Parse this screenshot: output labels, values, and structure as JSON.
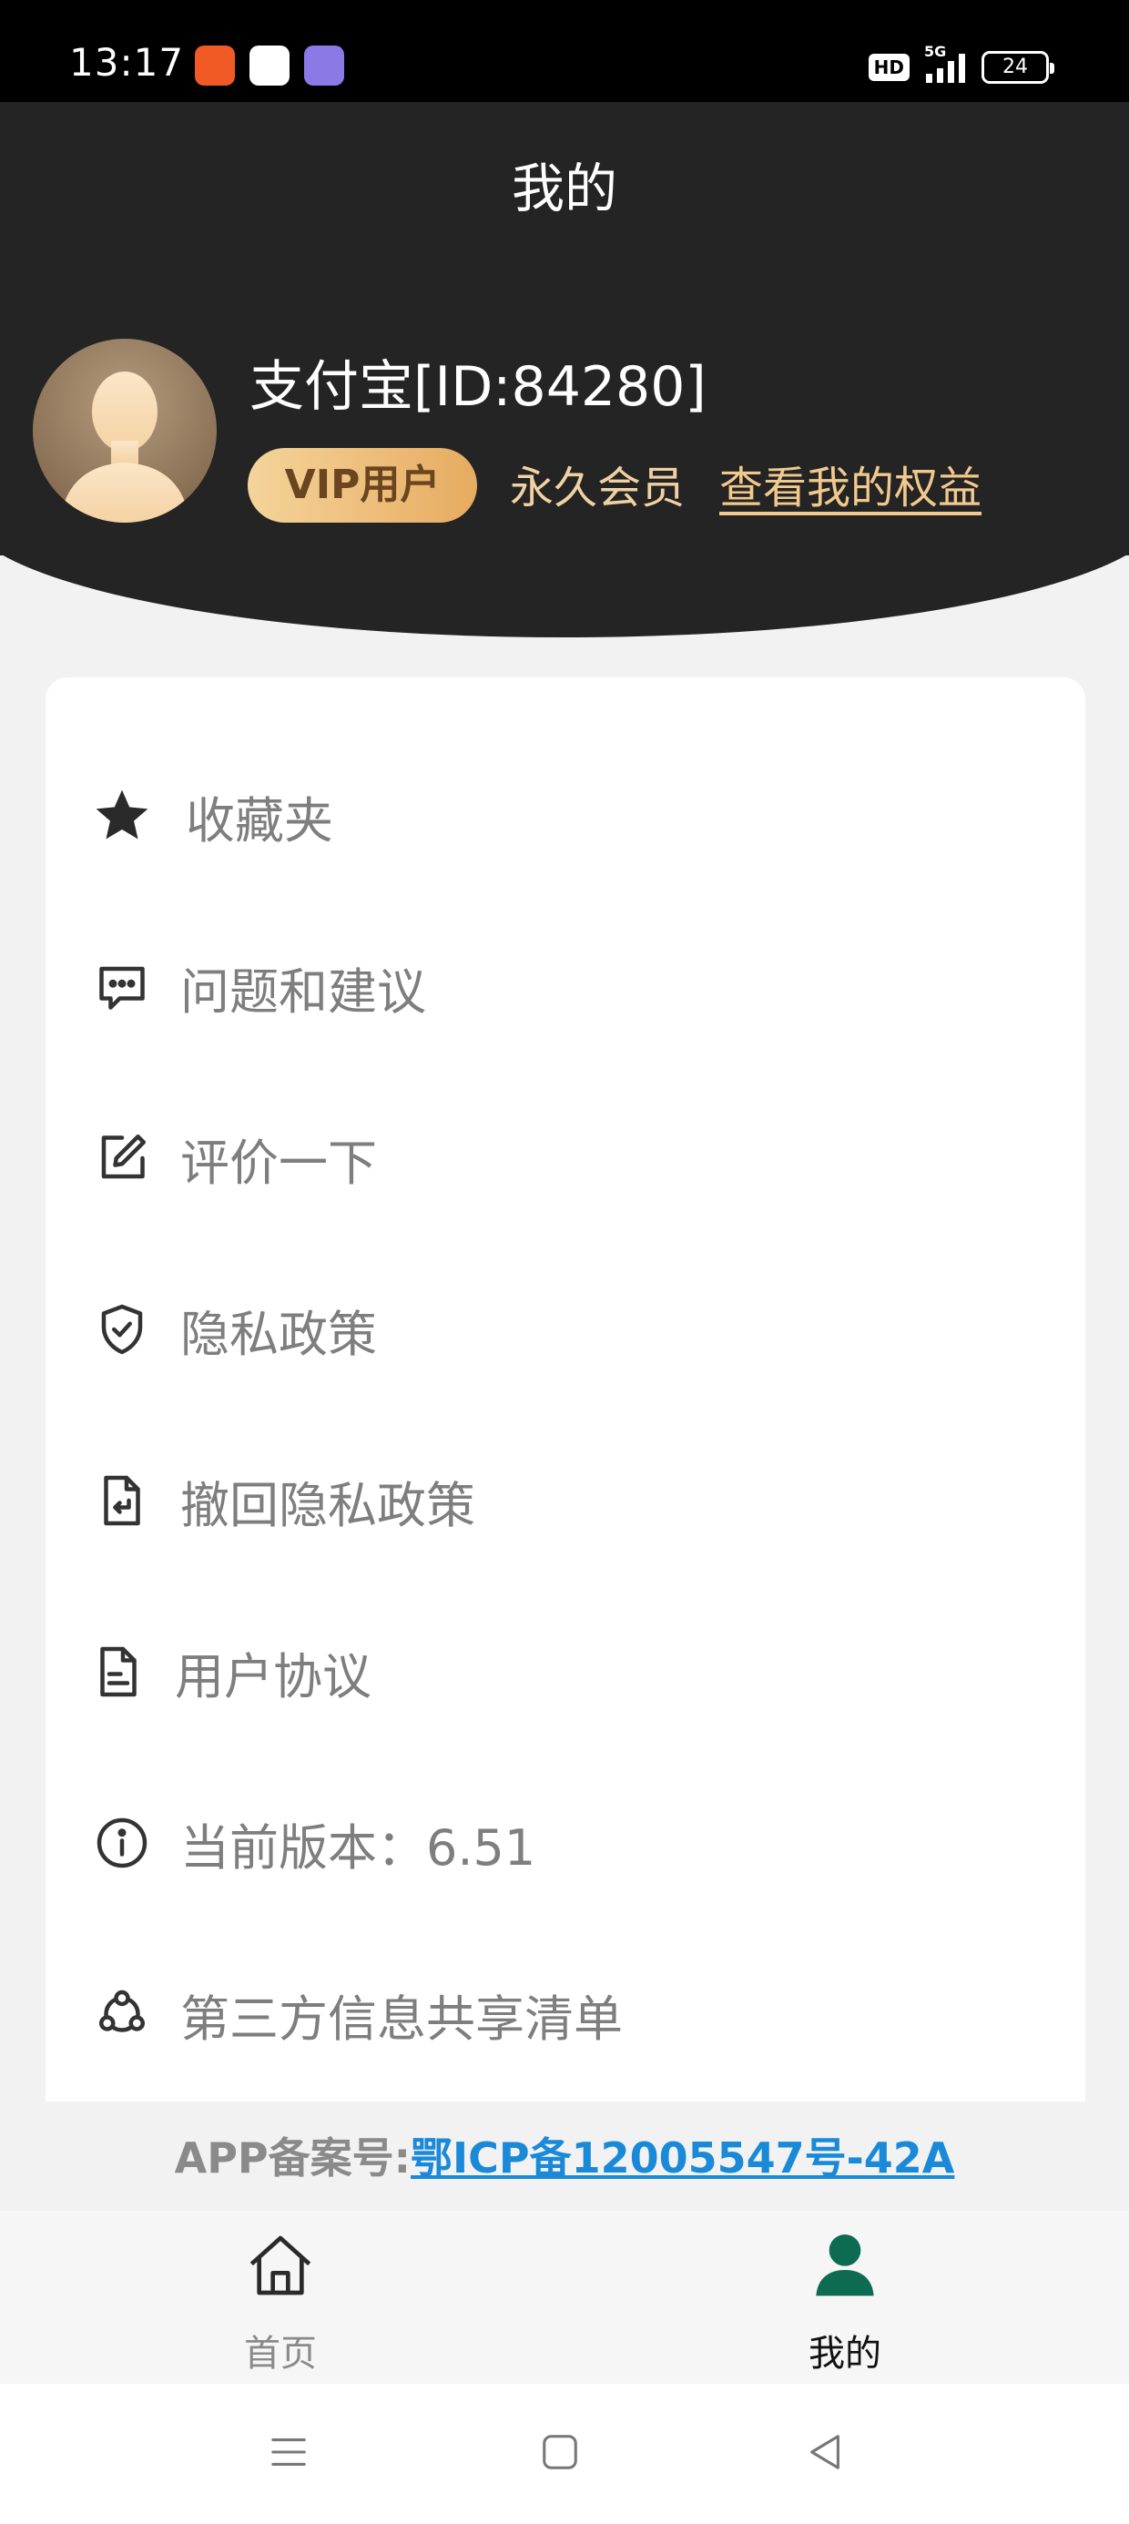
{
  "status_bar": {
    "time": "13:17",
    "network": "5G",
    "battery": "24",
    "hd": "HD"
  },
  "header": {
    "title": "我的",
    "username": "支付宝[ID:84280]",
    "vip_badge": "VIP用户",
    "membership": "永久会员",
    "benefits_link": "查看我的权益"
  },
  "menu": {
    "items": [
      {
        "label": "收藏夹",
        "icon": "star-icon"
      },
      {
        "label": "问题和建议",
        "icon": "chat-feedback-icon"
      },
      {
        "label": "评价一下",
        "icon": "edit-icon"
      },
      {
        "label": "隐私政策",
        "icon": "shield-check-icon"
      },
      {
        "label": "撤回隐私政策",
        "icon": "document-return-icon"
      },
      {
        "label": "用户协议",
        "icon": "document-icon"
      },
      {
        "label": "当前版本：6.51",
        "icon": "info-icon"
      },
      {
        "label": "第三方信息共享清单",
        "icon": "share-network-icon"
      }
    ]
  },
  "footer": {
    "icp_prefix": "APP备案号:",
    "icp_link": "鄂ICP备12005547号-42A"
  },
  "bottom_nav": {
    "home_label": "首页",
    "mine_label": "我的"
  },
  "colors": {
    "header_bg": "#242424",
    "accent_green": "#0d6b52",
    "vip_gold": "#f1c98d",
    "link_blue": "#1a8ad8"
  }
}
